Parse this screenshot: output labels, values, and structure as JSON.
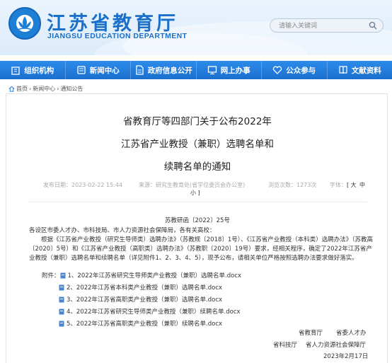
{
  "header": {
    "title": "江苏省教育厅",
    "subtitle": "JIANGSU EDUCATION DEPARTMENT",
    "search_placeholder": "请输入关键词"
  },
  "nav": [
    {
      "label": "组织机构",
      "icon": "building-icon"
    },
    {
      "label": "新闻中心",
      "icon": "newspaper-icon"
    },
    {
      "label": "政府信息公开",
      "icon": "document-icon"
    },
    {
      "label": "网上办事",
      "icon": "monitor-icon"
    },
    {
      "label": "公众参与",
      "icon": "heart-icon"
    },
    {
      "label": "文献资料",
      "icon": "book-icon"
    }
  ],
  "breadcrumb": [
    "首页",
    "新闻中心",
    "通知公告"
  ],
  "breadcrumb_sep": "›",
  "article": {
    "title_lines": [
      "省教育厅等四部门关于公布2022年",
      "江苏省产业教授（兼职）选聘名单和",
      "续聘名单的通知"
    ],
    "meta": {
      "published": "发布日期：2023-02-22 15:44",
      "source": "来源：研究生教育处(省学位委员会办公室)",
      "views": "浏览次数：1273次",
      "font_label": "字体：",
      "font_large": "[ 大",
      "font_medium": "中",
      "font_small": "小 ]"
    },
    "doc_number": "苏教研函〔2022〕25号",
    "salutation": "各设区市委人才办、市科技局、市人力资源社会保障局，各有关高校：",
    "paragraph": "根据《江苏省产业教授（研究生导师类）选聘办法》（苏教规〔2018〕1号）、《江苏省产业教授（本科类）选聘办法》（苏教高〔2020〕5号）和《江苏省产业教授（高职类）选聘办法》（苏教职〔2020〕19号）要求，经相关程序，确定了2022年江苏省产业教授（兼职）选聘名单和续聘名单（详见附件1、2、3、4、5），现予公布，请相关单位严格按照选聘办法要求做好落实。",
    "attachments_label": "附件：",
    "attachments": [
      "1、2022年江苏省研究生导师类产业教授（兼职）选聘名单.docx",
      "2、2022年江苏省本科类产业教授（兼职）选聘名单.docx",
      "3、2022年江苏省高职类产业教授（兼职）选聘名单.docx",
      "4、2022年江苏省研究生导师类产业教授（兼职）续聘名单.docx",
      "5、2022年江苏省高职类产业教授（兼职）续聘名单.docx"
    ],
    "signatories": [
      "省教育厅",
      "省委人才办",
      "省科技厅",
      "省人力资源社会保障厅"
    ],
    "date": "2023年2月17日"
  },
  "colors": {
    "brand": "#1a6fc9",
    "nav": "#1b6fce"
  }
}
